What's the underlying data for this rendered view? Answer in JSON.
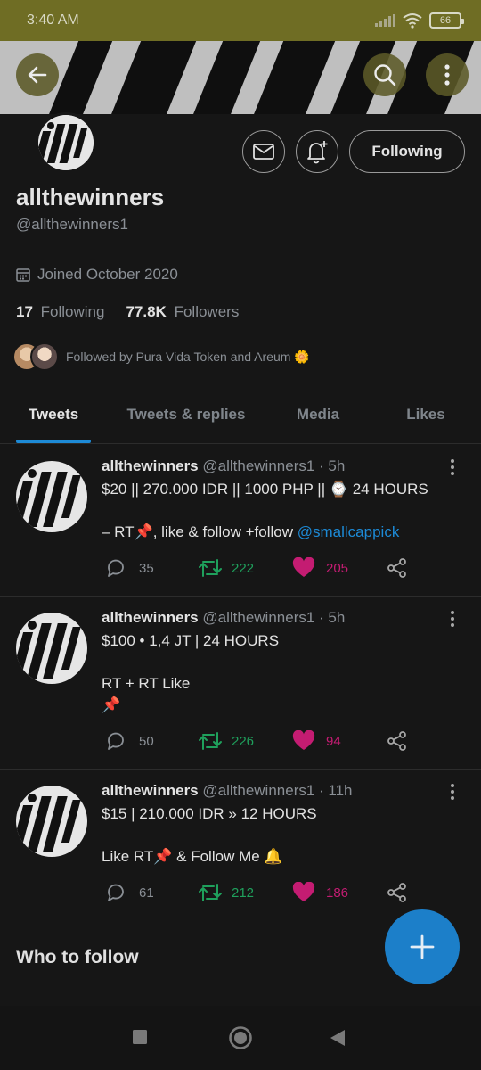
{
  "status_bar": {
    "time": "3:40 AM",
    "battery": "66"
  },
  "header": {
    "back_icon": "arrow-left-icon",
    "search_icon": "search-icon",
    "more_icon": "more-vertical-icon"
  },
  "profile": {
    "name": "allthewinners",
    "handle": "@allthewinners1",
    "joined": "Joined October 2020",
    "following_count": "17",
    "following_label": "Following",
    "followers_count": "77.8K",
    "followers_label": "Followers",
    "followed_by": "Followed by Pura Vida Token and Areum 🌼",
    "follow_button": "Following"
  },
  "tabs": [
    {
      "label": "Tweets",
      "active": true
    },
    {
      "label": "Tweets & replies",
      "active": false
    },
    {
      "label": "Media",
      "active": false
    },
    {
      "label": "Likes",
      "active": false
    }
  ],
  "tweets": [
    {
      "name": "allthewinners",
      "handle": "@allthewinners1 · 5h",
      "line1": "$20 || 270.000 IDR || 1000 PHP || ⌚ 24 HOURS",
      "line2": "– RT📌, like & follow +follow ",
      "mention": "@smallcappick",
      "replies": "35",
      "retweets": "222",
      "likes": "205"
    },
    {
      "name": "allthewinners",
      "handle": "@allthewinners1 · 5h",
      "line1": "$100 • 1,4 JT | 24 HOURS",
      "line2": "RT + RT Like",
      "line3": "📌",
      "replies": "50",
      "retweets": "226",
      "likes": "94"
    },
    {
      "name": "allthewinners",
      "handle": "@allthewinners1 · 11h",
      "line1": "$15 | 210.000 IDR » 12 HOURS",
      "line2": "Like RT📌 & Follow Me 🔔",
      "replies": "61",
      "retweets": "212",
      "likes": "186"
    }
  ],
  "who_to_follow": "Who to follow",
  "colors": {
    "accent": "#1d8ad6",
    "retweet": "#1fa05c",
    "like": "#c41c72",
    "status_bar": "#6f6d24"
  }
}
